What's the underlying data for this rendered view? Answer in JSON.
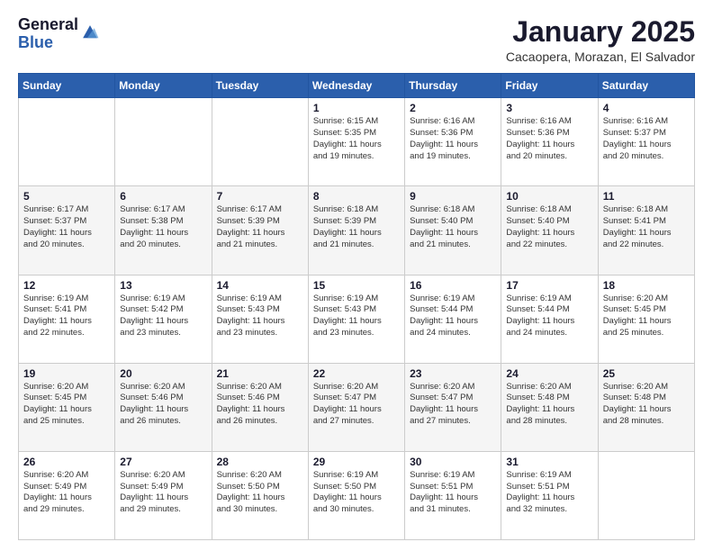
{
  "logo": {
    "general": "General",
    "blue": "Blue"
  },
  "header": {
    "month": "January 2025",
    "location": "Cacaopera, Morazan, El Salvador"
  },
  "weekdays": [
    "Sunday",
    "Monday",
    "Tuesday",
    "Wednesday",
    "Thursday",
    "Friday",
    "Saturday"
  ],
  "weeks": [
    [
      {
        "day": "",
        "info": ""
      },
      {
        "day": "",
        "info": ""
      },
      {
        "day": "",
        "info": ""
      },
      {
        "day": "1",
        "info": "Sunrise: 6:15 AM\nSunset: 5:35 PM\nDaylight: 11 hours\nand 19 minutes."
      },
      {
        "day": "2",
        "info": "Sunrise: 6:16 AM\nSunset: 5:36 PM\nDaylight: 11 hours\nand 19 minutes."
      },
      {
        "day": "3",
        "info": "Sunrise: 6:16 AM\nSunset: 5:36 PM\nDaylight: 11 hours\nand 20 minutes."
      },
      {
        "day": "4",
        "info": "Sunrise: 6:16 AM\nSunset: 5:37 PM\nDaylight: 11 hours\nand 20 minutes."
      }
    ],
    [
      {
        "day": "5",
        "info": "Sunrise: 6:17 AM\nSunset: 5:37 PM\nDaylight: 11 hours\nand 20 minutes."
      },
      {
        "day": "6",
        "info": "Sunrise: 6:17 AM\nSunset: 5:38 PM\nDaylight: 11 hours\nand 20 minutes."
      },
      {
        "day": "7",
        "info": "Sunrise: 6:17 AM\nSunset: 5:39 PM\nDaylight: 11 hours\nand 21 minutes."
      },
      {
        "day": "8",
        "info": "Sunrise: 6:18 AM\nSunset: 5:39 PM\nDaylight: 11 hours\nand 21 minutes."
      },
      {
        "day": "9",
        "info": "Sunrise: 6:18 AM\nSunset: 5:40 PM\nDaylight: 11 hours\nand 21 minutes."
      },
      {
        "day": "10",
        "info": "Sunrise: 6:18 AM\nSunset: 5:40 PM\nDaylight: 11 hours\nand 22 minutes."
      },
      {
        "day": "11",
        "info": "Sunrise: 6:18 AM\nSunset: 5:41 PM\nDaylight: 11 hours\nand 22 minutes."
      }
    ],
    [
      {
        "day": "12",
        "info": "Sunrise: 6:19 AM\nSunset: 5:41 PM\nDaylight: 11 hours\nand 22 minutes."
      },
      {
        "day": "13",
        "info": "Sunrise: 6:19 AM\nSunset: 5:42 PM\nDaylight: 11 hours\nand 23 minutes."
      },
      {
        "day": "14",
        "info": "Sunrise: 6:19 AM\nSunset: 5:43 PM\nDaylight: 11 hours\nand 23 minutes."
      },
      {
        "day": "15",
        "info": "Sunrise: 6:19 AM\nSunset: 5:43 PM\nDaylight: 11 hours\nand 23 minutes."
      },
      {
        "day": "16",
        "info": "Sunrise: 6:19 AM\nSunset: 5:44 PM\nDaylight: 11 hours\nand 24 minutes."
      },
      {
        "day": "17",
        "info": "Sunrise: 6:19 AM\nSunset: 5:44 PM\nDaylight: 11 hours\nand 24 minutes."
      },
      {
        "day": "18",
        "info": "Sunrise: 6:20 AM\nSunset: 5:45 PM\nDaylight: 11 hours\nand 25 minutes."
      }
    ],
    [
      {
        "day": "19",
        "info": "Sunrise: 6:20 AM\nSunset: 5:45 PM\nDaylight: 11 hours\nand 25 minutes."
      },
      {
        "day": "20",
        "info": "Sunrise: 6:20 AM\nSunset: 5:46 PM\nDaylight: 11 hours\nand 26 minutes."
      },
      {
        "day": "21",
        "info": "Sunrise: 6:20 AM\nSunset: 5:46 PM\nDaylight: 11 hours\nand 26 minutes."
      },
      {
        "day": "22",
        "info": "Sunrise: 6:20 AM\nSunset: 5:47 PM\nDaylight: 11 hours\nand 27 minutes."
      },
      {
        "day": "23",
        "info": "Sunrise: 6:20 AM\nSunset: 5:47 PM\nDaylight: 11 hours\nand 27 minutes."
      },
      {
        "day": "24",
        "info": "Sunrise: 6:20 AM\nSunset: 5:48 PM\nDaylight: 11 hours\nand 28 minutes."
      },
      {
        "day": "25",
        "info": "Sunrise: 6:20 AM\nSunset: 5:48 PM\nDaylight: 11 hours\nand 28 minutes."
      }
    ],
    [
      {
        "day": "26",
        "info": "Sunrise: 6:20 AM\nSunset: 5:49 PM\nDaylight: 11 hours\nand 29 minutes."
      },
      {
        "day": "27",
        "info": "Sunrise: 6:20 AM\nSunset: 5:49 PM\nDaylight: 11 hours\nand 29 minutes."
      },
      {
        "day": "28",
        "info": "Sunrise: 6:20 AM\nSunset: 5:50 PM\nDaylight: 11 hours\nand 30 minutes."
      },
      {
        "day": "29",
        "info": "Sunrise: 6:19 AM\nSunset: 5:50 PM\nDaylight: 11 hours\nand 30 minutes."
      },
      {
        "day": "30",
        "info": "Sunrise: 6:19 AM\nSunset: 5:51 PM\nDaylight: 11 hours\nand 31 minutes."
      },
      {
        "day": "31",
        "info": "Sunrise: 6:19 AM\nSunset: 5:51 PM\nDaylight: 11 hours\nand 32 minutes."
      },
      {
        "day": "",
        "info": ""
      }
    ]
  ]
}
